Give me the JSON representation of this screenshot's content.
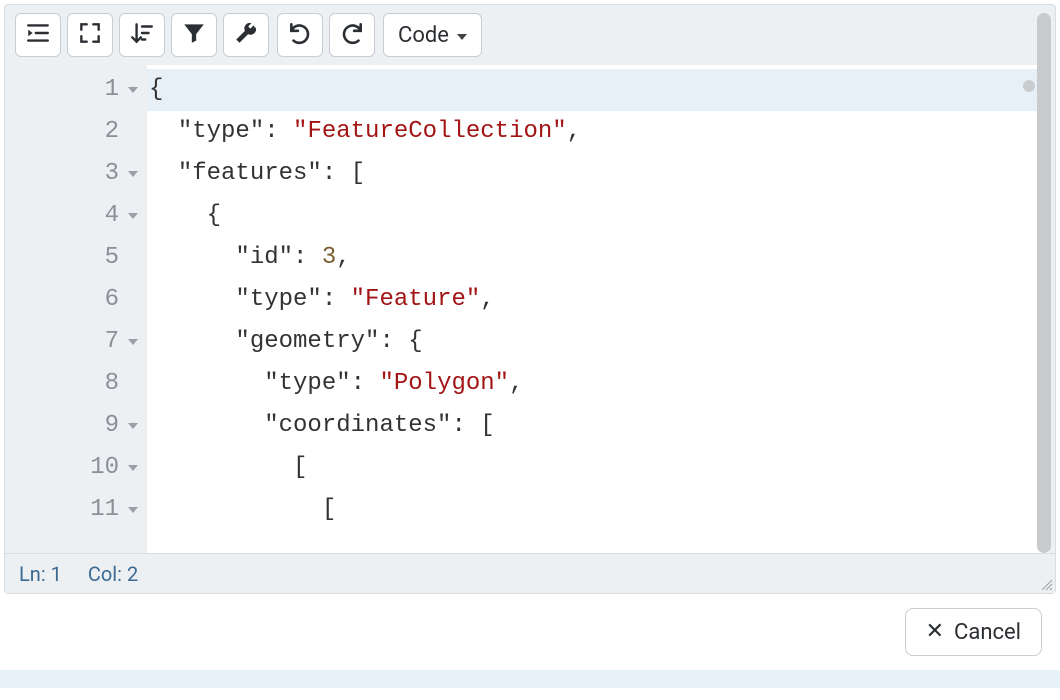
{
  "toolbar": {
    "code_select_label": "Code"
  },
  "editor": {
    "lines": [
      {
        "n": 1,
        "foldable": true,
        "active": true,
        "tokens": [
          {
            "t": "{",
            "c": "punc"
          }
        ]
      },
      {
        "n": 2,
        "foldable": false,
        "active": false,
        "tokens": [
          {
            "t": "  ",
            "c": "punc"
          },
          {
            "t": "\"type\"",
            "c": "key"
          },
          {
            "t": ": ",
            "c": "punc"
          },
          {
            "t": "\"FeatureCollection\"",
            "c": "str"
          },
          {
            "t": ",",
            "c": "punc"
          }
        ]
      },
      {
        "n": 3,
        "foldable": true,
        "active": false,
        "tokens": [
          {
            "t": "  ",
            "c": "punc"
          },
          {
            "t": "\"features\"",
            "c": "key"
          },
          {
            "t": ": [",
            "c": "punc"
          }
        ]
      },
      {
        "n": 4,
        "foldable": true,
        "active": false,
        "tokens": [
          {
            "t": "    {",
            "c": "punc"
          }
        ]
      },
      {
        "n": 5,
        "foldable": false,
        "active": false,
        "tokens": [
          {
            "t": "      ",
            "c": "punc"
          },
          {
            "t": "\"id\"",
            "c": "key"
          },
          {
            "t": ": ",
            "c": "punc"
          },
          {
            "t": "3",
            "c": "num"
          },
          {
            "t": ",",
            "c": "punc"
          }
        ]
      },
      {
        "n": 6,
        "foldable": false,
        "active": false,
        "tokens": [
          {
            "t": "      ",
            "c": "punc"
          },
          {
            "t": "\"type\"",
            "c": "key"
          },
          {
            "t": ": ",
            "c": "punc"
          },
          {
            "t": "\"Feature\"",
            "c": "str"
          },
          {
            "t": ",",
            "c": "punc"
          }
        ]
      },
      {
        "n": 7,
        "foldable": true,
        "active": false,
        "tokens": [
          {
            "t": "      ",
            "c": "punc"
          },
          {
            "t": "\"geometry\"",
            "c": "key"
          },
          {
            "t": ": {",
            "c": "punc"
          }
        ]
      },
      {
        "n": 8,
        "foldable": false,
        "active": false,
        "tokens": [
          {
            "t": "        ",
            "c": "punc"
          },
          {
            "t": "\"type\"",
            "c": "key"
          },
          {
            "t": ": ",
            "c": "punc"
          },
          {
            "t": "\"Polygon\"",
            "c": "str"
          },
          {
            "t": ",",
            "c": "punc"
          }
        ]
      },
      {
        "n": 9,
        "foldable": true,
        "active": false,
        "tokens": [
          {
            "t": "        ",
            "c": "punc"
          },
          {
            "t": "\"coordinates\"",
            "c": "key"
          },
          {
            "t": ": [",
            "c": "punc"
          }
        ]
      },
      {
        "n": 10,
        "foldable": true,
        "active": false,
        "tokens": [
          {
            "t": "          [",
            "c": "punc"
          }
        ]
      },
      {
        "n": 11,
        "foldable": true,
        "active": false,
        "tokens": [
          {
            "t": "            [",
            "c": "punc"
          }
        ]
      }
    ]
  },
  "status": {
    "line_label": "Ln: 1",
    "col_label": "Col: 2"
  },
  "footer": {
    "cancel_label": "Cancel"
  }
}
